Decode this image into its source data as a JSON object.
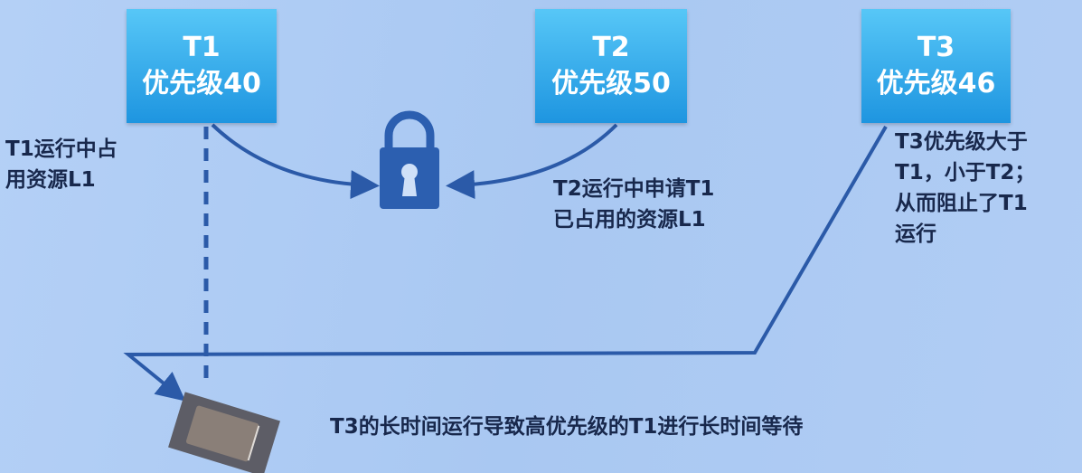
{
  "tasks": [
    {
      "name": "T1",
      "priority": "优先级40"
    },
    {
      "name": "T2",
      "priority": "优先级50"
    },
    {
      "name": "T3",
      "priority": "优先级46"
    }
  ],
  "notes": {
    "t1": [
      "T1运行中占",
      "用资源L1"
    ],
    "t2": [
      "T2运行中申请T1",
      "已占用的资源L1"
    ],
    "t3": [
      "T3优先级大于",
      "T1，小于T2；",
      "从而阻止了T1",
      "运行"
    ],
    "bottom": "T3的长时间运行导致高优先级的T1进行长时间等待"
  },
  "colors": {
    "box": "#2a9fe6",
    "arrow": "#2b5aa8",
    "lock": "#2c5fb0"
  }
}
